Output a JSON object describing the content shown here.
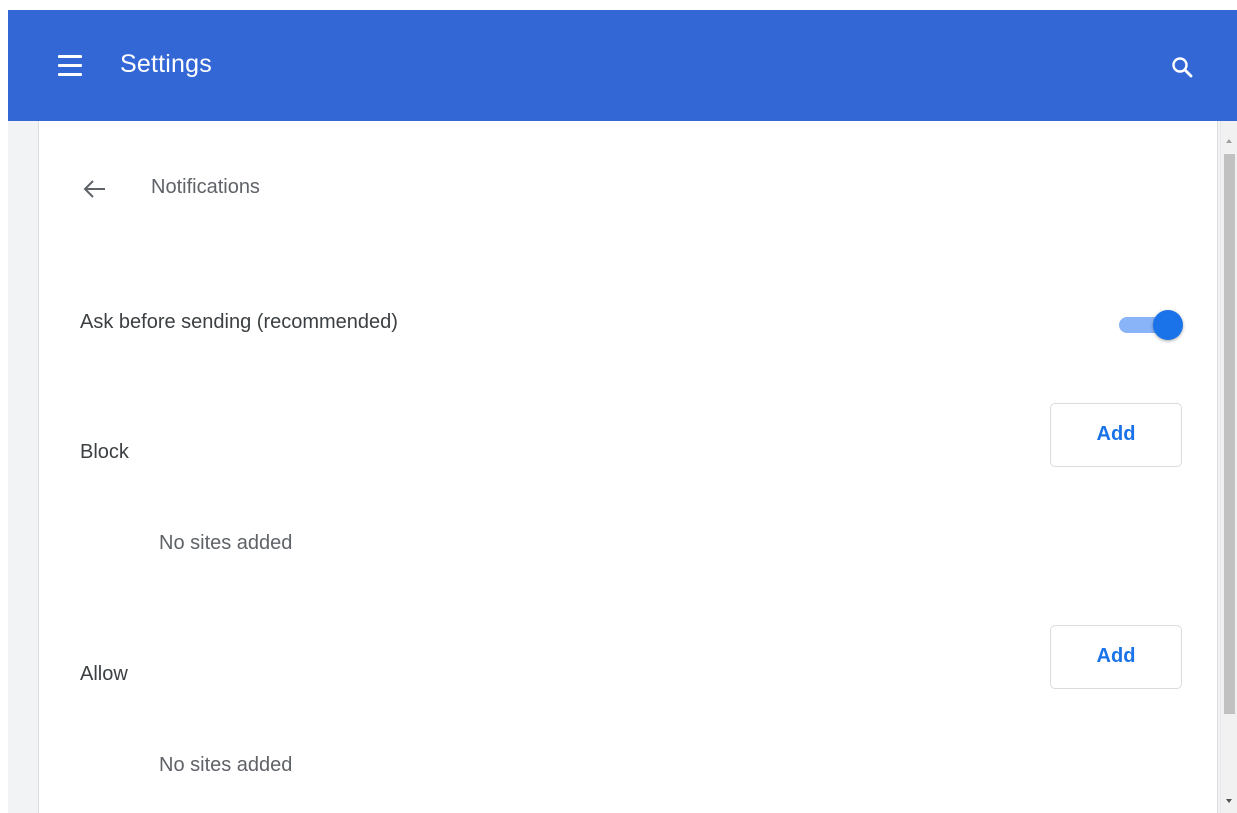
{
  "toolbar": {
    "title": "Settings",
    "menu_icon": "menu-icon",
    "search_icon": "search-icon",
    "color": "#3367d6"
  },
  "page": {
    "title": "Notifications",
    "back_icon": "arrow-back-icon"
  },
  "ask_setting": {
    "label": "Ask before sending (recommended)",
    "enabled": true,
    "accent": "#1a73e8"
  },
  "block": {
    "label": "Block",
    "add_label": "Add",
    "empty_text": "No sites added"
  },
  "allow": {
    "label": "Allow",
    "add_label": "Add",
    "empty_text": "No sites added"
  }
}
